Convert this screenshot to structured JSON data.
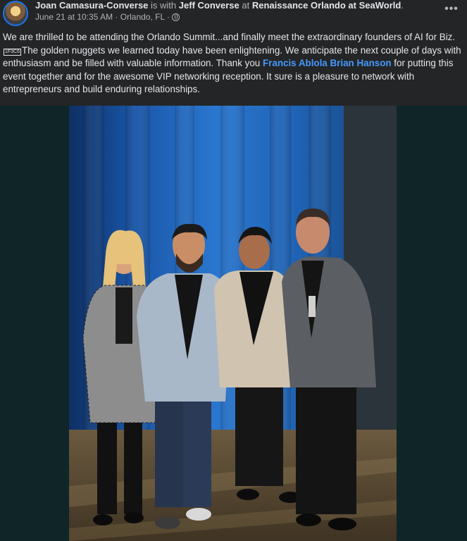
{
  "post": {
    "author": "Joan Camasura-Converse",
    "with_text": "is with",
    "tagged": "Jeff Converse",
    "at_text": "at",
    "location": "Renaissance Orlando at SeaWorld",
    "period": ".",
    "timestamp": "June 21 at 10:35 AM",
    "separator": "·",
    "city": "Orlando, FL",
    "separator2": "·",
    "more_label": "•••",
    "text_part1": "We are thrilled to be attending the Orlando Summit...and finally meet the extraordinary founders of AI for Biz.",
    "symbol": "1F3C6",
    "text_part2": "The golden nuggets we learned today have been enlightening. We anticipate the next couple of days with enthusiasm and be filled with valuable information. Thank you",
    "link1": "Francis Ablola",
    "link2": "Brian Hanson",
    "text_part3": "for putting this event together and for the awesome VIP networking reception. It sure is a pleasure to network with entrepreneurs and build enduring relationships."
  },
  "colors": {
    "background": "#242526",
    "link": "#4599ff",
    "curtain": "#1b5fae",
    "photo_margin": "#0f2528"
  },
  "icons": {
    "privacy": "globe-icon",
    "menu": "more-options-icon"
  }
}
